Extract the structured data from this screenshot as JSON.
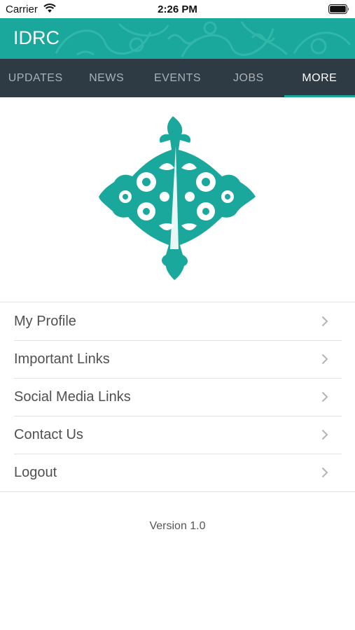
{
  "status_bar": {
    "carrier": "Carrier",
    "time": "2:26 PM"
  },
  "header": {
    "title": "IDRC",
    "brand_color": "#1ba89c"
  },
  "tabs": [
    {
      "label": "UPDATES",
      "active": false
    },
    {
      "label": "NEWS",
      "active": false
    },
    {
      "label": "EVENTS",
      "active": false
    },
    {
      "label": "JOBS",
      "active": false
    },
    {
      "label": "MORE",
      "active": true
    }
  ],
  "menu": {
    "items": [
      {
        "label": "My Profile"
      },
      {
        "label": "Important Links"
      },
      {
        "label": "Social Media Links"
      },
      {
        "label": "Contact Us"
      },
      {
        "label": "Logout"
      }
    ]
  },
  "footer": {
    "version": "Version 1.0"
  },
  "icons": {
    "wifi": "wifi-icon",
    "battery": "battery-icon",
    "chevron": "chevron-right-icon",
    "logo": "idrc-ornament-logo"
  }
}
